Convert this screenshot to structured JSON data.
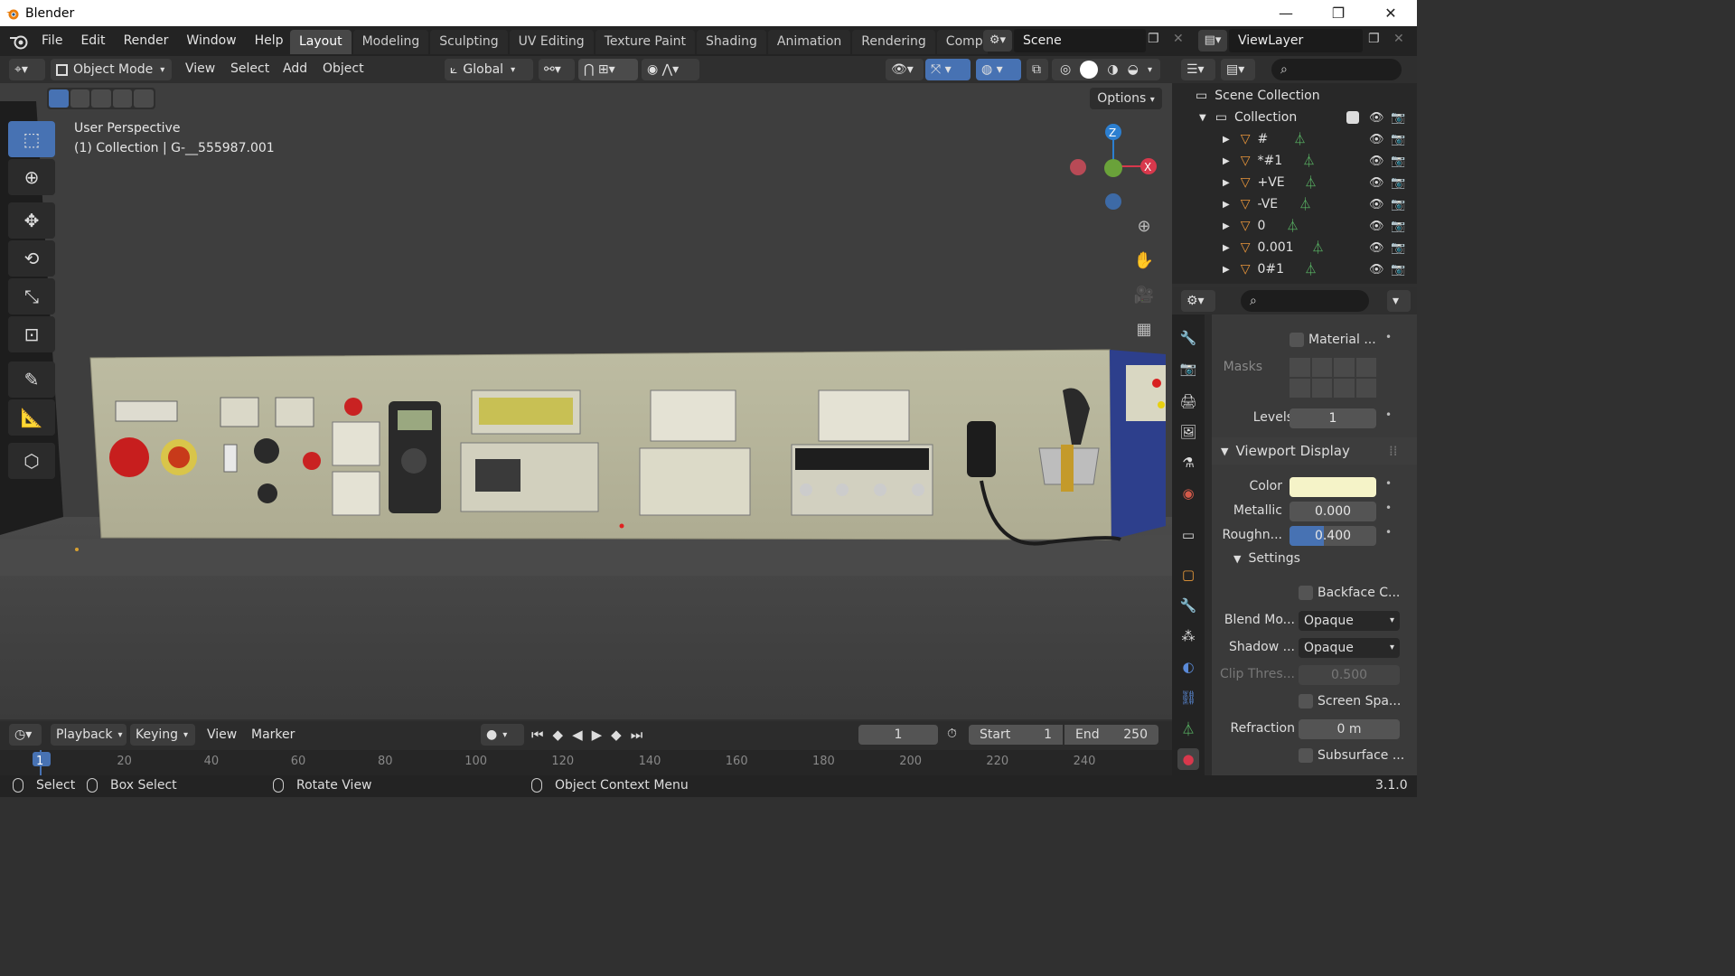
{
  "window": {
    "title": "Blender",
    "minimize": "—",
    "maximize": "❐",
    "close": "✕"
  },
  "menu": {
    "items": [
      "File",
      "Edit",
      "Render",
      "Window",
      "Help"
    ]
  },
  "workspaces": [
    "Layout",
    "Modeling",
    "Sculpting",
    "UV Editing",
    "Texture Paint",
    "Shading",
    "Animation",
    "Rendering",
    "Compo"
  ],
  "active_workspace": "Layout",
  "scene": {
    "name": "Scene",
    "view_layer": "ViewLayer"
  },
  "header3d": {
    "mode": "Object Mode",
    "view": "View",
    "select": "Select",
    "add": "Add",
    "object": "Object",
    "transform": "Global",
    "options": "Options"
  },
  "viewport": {
    "perspective": "User Perspective",
    "collection_info": "(1) Collection | G-__555987.001",
    "gizmo": {
      "z": "Z",
      "x": "X"
    }
  },
  "outliner": {
    "root": "Scene Collection",
    "collection": "Collection",
    "items": [
      "#",
      "*#1",
      "+VE",
      "-VE",
      "0",
      "0.001",
      "0#1"
    ]
  },
  "properties": {
    "material_label": "Material ...",
    "masks_label": "Masks",
    "levels_label": "Levels",
    "levels_value": "1",
    "viewport_display": "Viewport Display",
    "color_label": "Color",
    "color_value": "#f5f3c8",
    "metallic_label": "Metallic",
    "metallic_value": "0.000",
    "roughness_label": "Roughn...",
    "roughness_value": "0.400",
    "settings": "Settings",
    "backface_label": "Backface C...",
    "blend_label": "Blend Mo...",
    "blend_value": "Opaque",
    "shadow_label": "Shadow ...",
    "shadow_value": "Opaque",
    "clip_label": "Clip Thres...",
    "clip_value": "0.500",
    "screen_space_label": "Screen Spa...",
    "refraction_label": "Refraction",
    "refraction_value": "0 m",
    "subsurface_label": "Subsurface ..."
  },
  "timeline": {
    "playback": "Playback",
    "keying": "Keying",
    "view": "View",
    "marker": "Marker",
    "current_frame": "1",
    "start_label": "Start",
    "start": "1",
    "end_label": "End",
    "end": "250",
    "ticks": [
      "1",
      "20",
      "40",
      "60",
      "80",
      "100",
      "120",
      "140",
      "160",
      "180",
      "200",
      "220",
      "240"
    ]
  },
  "status": {
    "select": "Select",
    "box_select": "Box Select",
    "rotate_view": "Rotate View",
    "context_menu": "Object Context Menu",
    "version": "3.1.0"
  },
  "colors": {
    "accent": "#4772b3",
    "active_tab": "#474747",
    "viewport_bg": "#393939"
  }
}
